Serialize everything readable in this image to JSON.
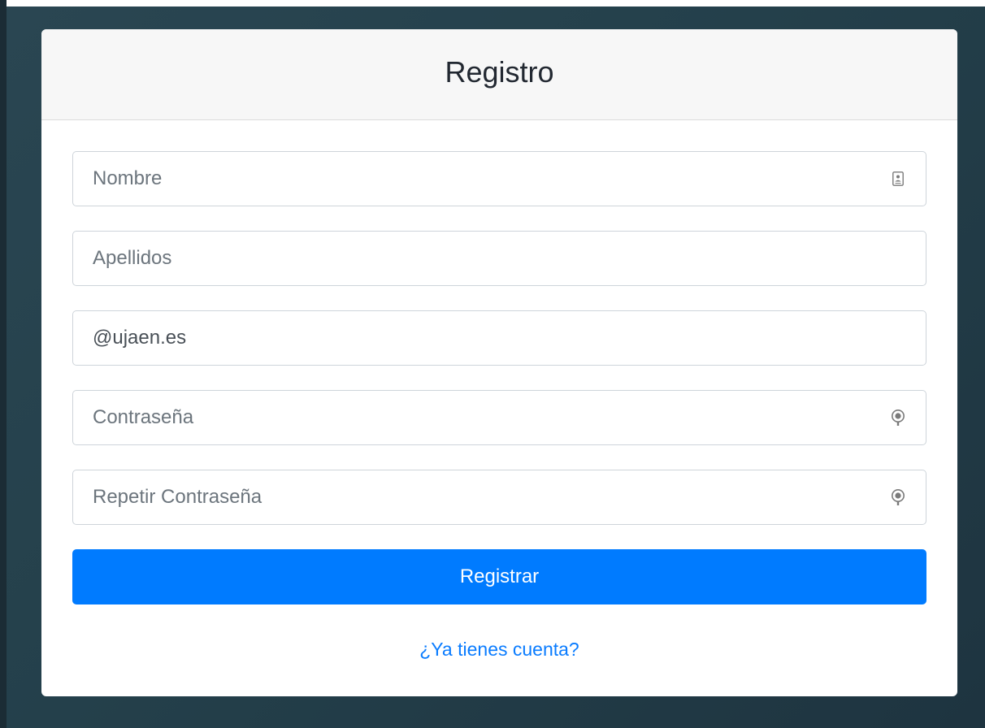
{
  "form": {
    "title": "Registro",
    "fields": [
      {
        "placeholder": "Nombre",
        "value": "",
        "icon": "contact-card-icon"
      },
      {
        "placeholder": "Apellidos",
        "value": ""
      },
      {
        "placeholder": "",
        "value": "@ujaen.es"
      },
      {
        "placeholder": "Contraseña",
        "value": "",
        "icon": "password-key-icon"
      },
      {
        "placeholder": "Repetir Contraseña",
        "value": "",
        "icon": "password-key-icon"
      }
    ],
    "submit_label": "Registrar",
    "login_link": "¿Ya tienes cuenta?"
  },
  "colors": {
    "primary": "#007bff",
    "link": "#0a7cff",
    "background": "#24404b",
    "header_bg": "#f7f7f7"
  }
}
